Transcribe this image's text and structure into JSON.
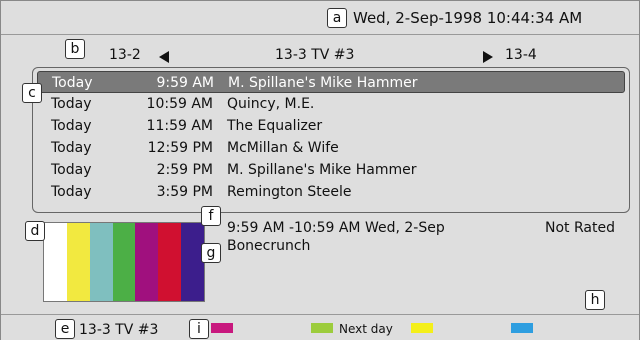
{
  "header": {
    "datetime": "Wed, 2-Sep-1998   10:44:34 AM"
  },
  "channel_nav": {
    "prev": "13-2",
    "current": "13-3   TV #3",
    "next": "13-4"
  },
  "listings": [
    {
      "day": "Today",
      "time": "9:59 AM",
      "title": "M. Spillane's Mike Hammer",
      "selected": true
    },
    {
      "day": "Today",
      "time": "10:59 AM",
      "title": "Quincy, M.E."
    },
    {
      "day": "Today",
      "time": "11:59 AM",
      "title": "The Equalizer"
    },
    {
      "day": "Today",
      "time": "12:59 PM",
      "title": "McMillan & Wife"
    },
    {
      "day": "Today",
      "time": "2:59 PM",
      "title": "M. Spillane's Mike Hammer"
    },
    {
      "day": "Today",
      "time": "3:59 PM",
      "title": "Remington Steele"
    }
  ],
  "details": {
    "time_range": "9:59  AM -10:59 AM  Wed, 2-Sep",
    "rating": "Not Rated",
    "description": "Bonecrunch"
  },
  "preview": {
    "bar_colors": [
      "#ffffff",
      "#f2e940",
      "#7fbfbf",
      "#4caf46",
      "#a0107e",
      "#d01030",
      "#3c1e8c"
    ]
  },
  "footer": {
    "channel": "13-3   TV #3",
    "buttons": [
      {
        "color": "#c8187e",
        "label": ""
      },
      {
        "color": "#9ccc3c",
        "label": "Next day"
      },
      {
        "color": "#f4ef1a",
        "label": ""
      },
      {
        "color": "#2e9ee0",
        "label": ""
      }
    ]
  },
  "markers": [
    "a",
    "b",
    "c",
    "d",
    "e",
    "f",
    "g",
    "h",
    "i"
  ]
}
